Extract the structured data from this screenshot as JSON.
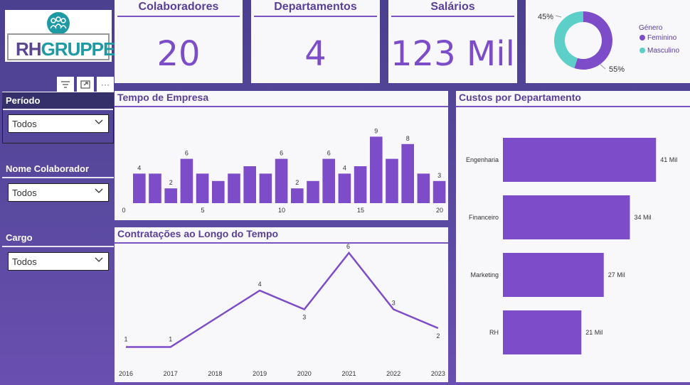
{
  "logo": {
    "rh": "RH",
    "gruppe": "GRUPPE"
  },
  "toolbar": {
    "filter_icon": "filter-icon",
    "focus_icon": "focus-mode-icon",
    "more_icon": "more-options-icon",
    "more_label": "···"
  },
  "slicers": [
    {
      "title": "Período",
      "value": "Todos"
    },
    {
      "title": "Nome Colaborador",
      "value": "Todos"
    },
    {
      "title": "Cargo",
      "value": "Todos"
    }
  ],
  "kpis": [
    {
      "title": "Colaboradores",
      "value": "20"
    },
    {
      "title": "Departamentos",
      "value": "4"
    },
    {
      "title": "Salários",
      "value": "123 Mil"
    }
  ],
  "gender": {
    "legend_title": "Género",
    "colors": {
      "Feminino": "#7d4cc8",
      "Masculino": "#5ccfc9"
    }
  },
  "sections": {
    "tempo": "Tempo de Empresa",
    "contratacoes": "Contratações ao Longo do Tempo",
    "custos": "Custos por Departamento"
  },
  "chart_data": [
    {
      "type": "pie",
      "legend_title": "Género",
      "categories": [
        "Feminino",
        "Masculino"
      ],
      "values": [
        55,
        45
      ],
      "labels": [
        "55%",
        "45%"
      ]
    },
    {
      "type": "bar",
      "title": "Tempo de Empresa",
      "x": [
        0,
        1,
        2,
        3,
        4,
        5,
        6,
        7,
        8,
        9,
        10,
        11,
        12,
        13,
        14,
        15,
        16,
        17,
        18,
        19,
        20
      ],
      "values": [
        4,
        4,
        2,
        6,
        4,
        3,
        4,
        5,
        4,
        6,
        2,
        3,
        6,
        4,
        5,
        9,
        6,
        8,
        4,
        3,
        null
      ],
      "data_labels": {
        "1": "4",
        "3": "2",
        "4": "6",
        "10": "6",
        "11": "2",
        "13": "6",
        "14": "4",
        "16": "9",
        "18": "8",
        "20": "3"
      },
      "x_ticks": [
        0,
        5,
        10,
        15,
        20
      ]
    },
    {
      "type": "line",
      "title": "Contratações ao Longo do Tempo",
      "categories": [
        "2016",
        "2017",
        "2018",
        "2019",
        "2020",
        "2021",
        "2022",
        "2023"
      ],
      "values": [
        1,
        1,
        null,
        4,
        3,
        6,
        3,
        2
      ],
      "data_labels": [
        "1",
        "1",
        "",
        "4",
        "3",
        "6",
        "3",
        "2"
      ]
    },
    {
      "type": "bar",
      "orientation": "horizontal",
      "title": "Custos por Departamento",
      "categories": [
        "Engenharia",
        "Financeiro",
        "Marketing",
        "RH"
      ],
      "values": [
        41,
        34,
        27,
        21
      ],
      "data_labels": [
        "41 Mil",
        "34 Mil",
        "27 Mil",
        "21 Mil"
      ]
    }
  ]
}
